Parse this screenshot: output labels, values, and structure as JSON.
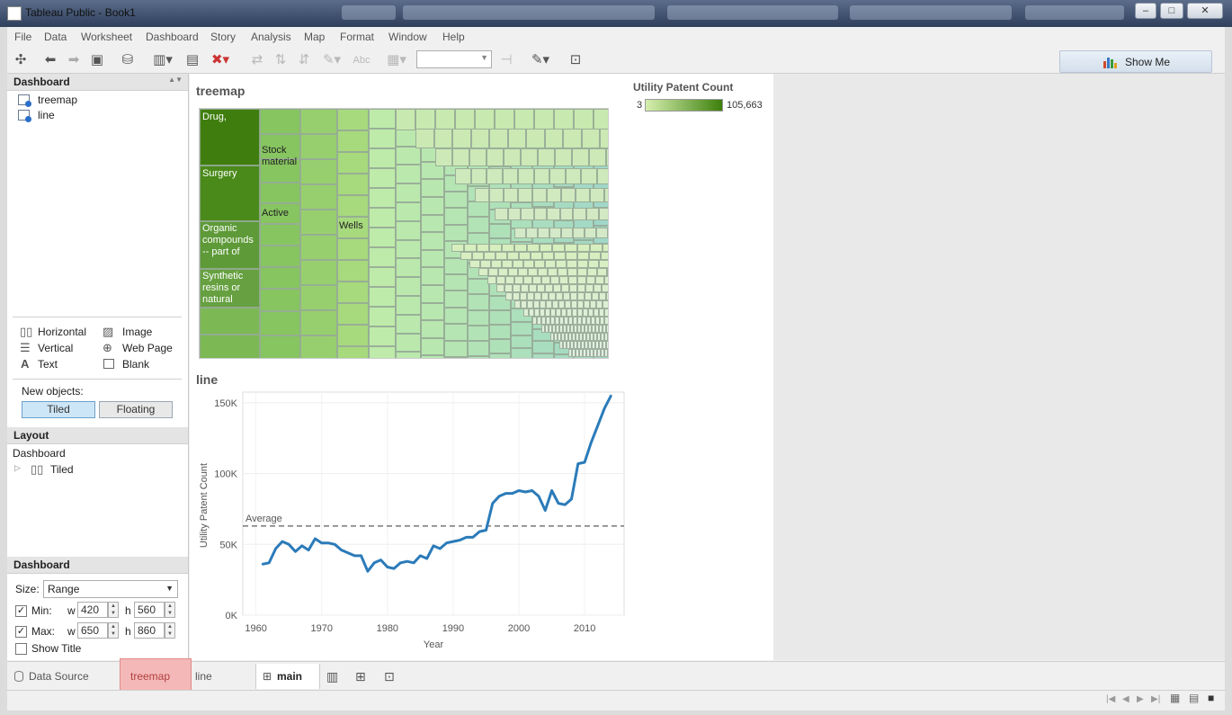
{
  "window": {
    "title": "Tableau Public - Book1",
    "controls": [
      "–",
      "□",
      "✕"
    ]
  },
  "menu": [
    "File",
    "Data",
    "Worksheet",
    "Dashboard",
    "Story",
    "Analysis",
    "Map",
    "Format",
    "Window",
    "Help"
  ],
  "toolbar": {
    "show_me": "Show Me",
    "abc": "Abc"
  },
  "left_pane": {
    "dashboard_header": "Dashboard",
    "sheets": [
      "treemap",
      "line"
    ],
    "objects": {
      "horizontal": "Horizontal",
      "vertical": "Vertical",
      "text": "Text",
      "image": "Image",
      "web_page": "Web Page",
      "blank": "Blank"
    },
    "new_objects_label": "New objects:",
    "tiled_btn": "Tiled",
    "floating_btn": "Floating",
    "layout_header": "Layout",
    "layout_root": "Dashboard",
    "layout_child": "Tiled",
    "size_header": "Dashboard",
    "size_label": "Size:",
    "size_value": "Range",
    "min_label": "Min:",
    "max_label": "Max:",
    "w": "w",
    "h": "h",
    "min_w": "420",
    "min_h": "560",
    "max_w": "650",
    "max_h": "860",
    "show_title": "Show Title"
  },
  "treemap": {
    "title": "treemap",
    "labels": {
      "drug": "Drug,",
      "surgery": "Surgery",
      "organic": "Organic compounds -- part of",
      "synthetic": "Synthetic resins or natural",
      "stock": "Stock material",
      "active": "Active",
      "wells": "Wells"
    },
    "legend": {
      "title": "Utility Patent Count",
      "min": "3",
      "max": "105,663",
      "color_low": "#d6efaf",
      "color_high": "#3d800c"
    }
  },
  "chart_data": {
    "type": "line",
    "title": "line",
    "xlabel": "Year",
    "ylabel": "Utility Patent Count",
    "xlim": [
      1958,
      2016
    ],
    "ylim": [
      0,
      155000
    ],
    "x_ticks": [
      "1960",
      "1970",
      "1980",
      "1990",
      "2000",
      "2010"
    ],
    "y_ticks": [
      "0K",
      "50K",
      "100K",
      "150K"
    ],
    "reference_line": {
      "label": "Average",
      "value": 63000
    },
    "color": "#2b7bb9",
    "x": [
      1961,
      1962,
      1963,
      1964,
      1965,
      1966,
      1967,
      1968,
      1969,
      1970,
      1971,
      1972,
      1973,
      1974,
      1975,
      1976,
      1977,
      1978,
      1979,
      1980,
      1981,
      1982,
      1983,
      1984,
      1985,
      1986,
      1987,
      1988,
      1989,
      1990,
      1991,
      1992,
      1993,
      1994,
      1995,
      1996,
      1997,
      1998,
      1999,
      2000,
      2001,
      2002,
      2003,
      2004,
      2005,
      2006,
      2007,
      2008,
      2009,
      2010,
      2011,
      2012,
      2013,
      2014
    ],
    "y": [
      36000,
      37000,
      47000,
      52000,
      50000,
      45000,
      49000,
      46000,
      54000,
      51000,
      51000,
      50000,
      46000,
      44000,
      42000,
      42000,
      31000,
      37000,
      39000,
      34000,
      33000,
      37000,
      38000,
      37000,
      42000,
      40000,
      49000,
      47000,
      51000,
      52000,
      53000,
      55000,
      55000,
      59000,
      60000,
      79000,
      84000,
      86000,
      86000,
      88000,
      87000,
      88000,
      84000,
      74000,
      88000,
      79000,
      78000,
      82000,
      107000,
      108000,
      122000,
      134000,
      146000,
      155000
    ]
  },
  "tabs": {
    "data_source": "Data Source",
    "treemap": "treemap",
    "line": "line",
    "main": "main"
  }
}
